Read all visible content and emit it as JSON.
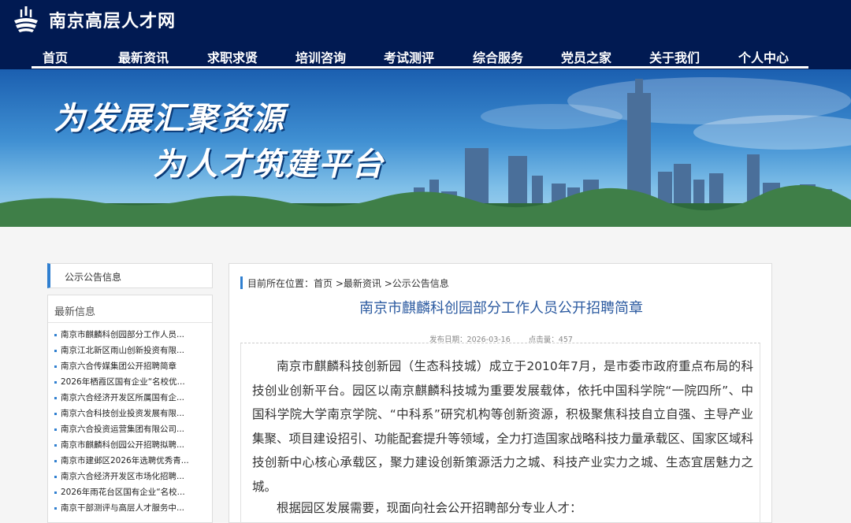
{
  "header": {
    "site_title": "南京高层人才网",
    "logo_icon": "nanjing-talent-logo",
    "nav": [
      "首页",
      "最新资讯",
      "求职求贤",
      "培训咨询",
      "考试测评",
      "综合服务",
      "党员之家",
      "关于我们",
      "个人中心"
    ]
  },
  "banner": {
    "slogan_line1": "为发展汇聚资源",
    "slogan_line2": "为人才筑建平台"
  },
  "sidebar": {
    "section_label": "公示公告信息",
    "latest_title": "最新信息",
    "items": [
      "南京市麒麟科创园部分工作人员...",
      "南京江北新区雨山创新投资有限...",
      "南京六合传媒集团公开招聘简章",
      "2026年栖霞区国有企业“名校优...",
      "南京六合经济开发区所属国有企...",
      "南京六合科技创业投资发展有限...",
      "南京六合投资运营集团有限公司...",
      "南京市麒麟科创园公开招聘拟聘...",
      "南京市建邺区2026年选聘优秀青...",
      "南京六合经济开发区市场化招聘...",
      "2026年雨花台区国有企业“名校...",
      "南京干部测评与高层人才服务中..."
    ]
  },
  "main": {
    "breadcrumb_prefix": "目前所在位置：",
    "breadcrumb": [
      "首页",
      "最新资讯",
      "公示公告信息"
    ],
    "breadcrumb_sep": " >",
    "title": "南京市麒麟科创园部分工作人员公开招聘简章",
    "publish_date": "发布日期：2026-03-16",
    "views": "点击量：457",
    "paragraph1": "南京市麒麟科技创新园（生态科技城）成立于2010年7月，是市委市政府重点布局的科技创业创新平台。园区以南京麒麟科技城为重要发展载体，依托中国科学院“一院四所”、中国科学院大学南京学院、“中科系”研究机构等创新资源，积极聚焦科技自立自强、主导产业集聚、项目建设招引、功能配套提升等领域，全力打造国家战略科技力量承载区、国家区域科技创新中心核心承载区，聚力建设创新策源活力之城、科技产业实力之城、生态宜居魅力之城。",
    "paragraph2": "根据园区发展需要，现面向社会公开招聘部分专业人才："
  }
}
